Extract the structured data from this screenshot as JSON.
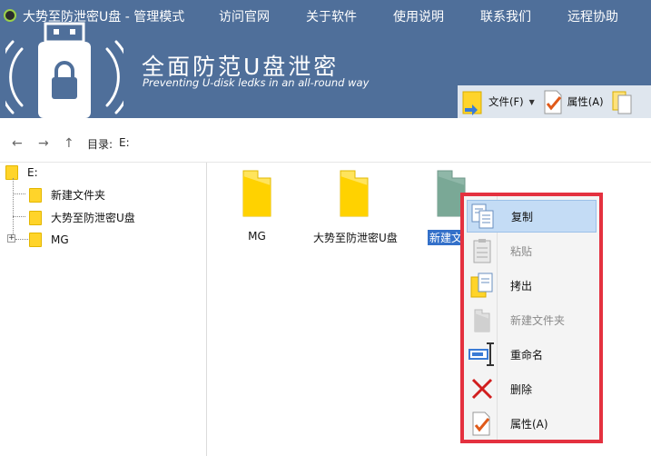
{
  "app": {
    "title": "大势至防泄密U盘 - 管理模式",
    "menu": [
      "访问官网",
      "关于软件",
      "使用说明",
      "联系我们",
      "远程协助"
    ],
    "slogan": "全面防范U盘泄密",
    "slogan_en": "Preventing U-disk ledks in an all-round way"
  },
  "toolbar": {
    "file_label": "文件(F)",
    "properties_label": "属性(A)"
  },
  "nav": {
    "back": "←",
    "forward": "→",
    "up": "↑",
    "path_label": "目录:",
    "path_value": "E:"
  },
  "tree": {
    "root": "E:",
    "items": [
      "新建文件夹",
      "大势至防泄密U盘",
      "MG"
    ]
  },
  "files": [
    {
      "name": "MG",
      "selected": false
    },
    {
      "name": "大势至防泄密U盘",
      "selected": false
    },
    {
      "name": "新建文件",
      "selected": true
    }
  ],
  "context_menu": {
    "items": [
      {
        "label": "复制",
        "icon": "copy-icon",
        "enabled": true,
        "highlighted": true
      },
      {
        "label": "粘贴",
        "icon": "paste-icon",
        "enabled": false,
        "highlighted": false
      },
      {
        "label": "拷出",
        "icon": "export-icon",
        "enabled": true,
        "highlighted": false
      },
      {
        "label": "新建文件夹",
        "icon": "new-folder-icon",
        "enabled": false,
        "highlighted": false
      },
      {
        "label": "重命名",
        "icon": "rename-icon",
        "enabled": true,
        "highlighted": false
      },
      {
        "label": "删除",
        "icon": "delete-icon",
        "enabled": true,
        "highlighted": false
      },
      {
        "label": "属性(A)",
        "icon": "properties-icon",
        "enabled": true,
        "highlighted": false
      }
    ]
  },
  "colors": {
    "header": "#4f6f9a",
    "folder": "#ffd42a",
    "selection": "#3370c9",
    "menu_border": "#e4313f",
    "menu_highlight": "#c4dcf5"
  }
}
